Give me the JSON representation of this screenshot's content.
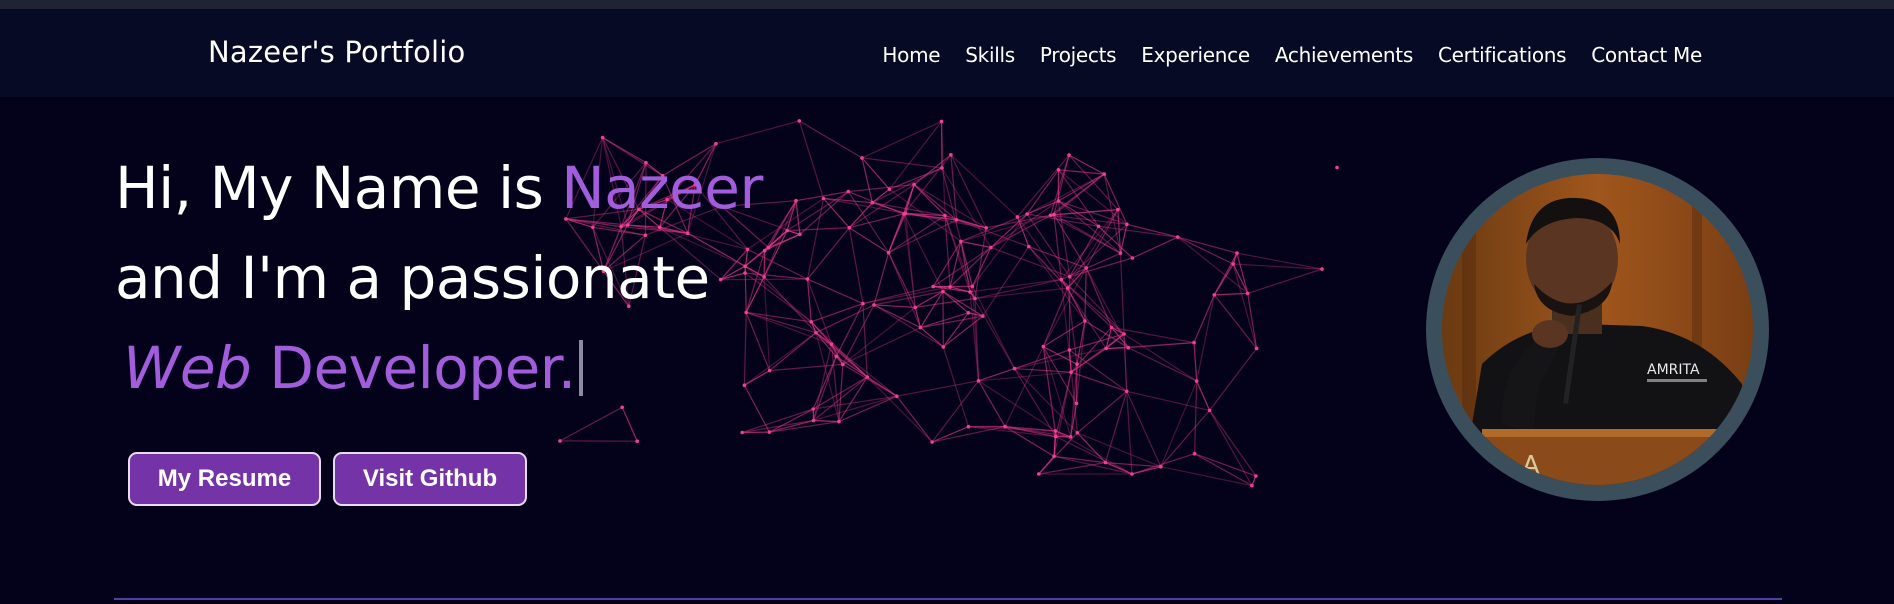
{
  "navbar": {
    "brand": "Nazeer's Portfolio",
    "links": [
      "Home",
      "Skills",
      "Projects",
      "Experience",
      "Achievements",
      "Certifications",
      "Contact Me"
    ]
  },
  "hero": {
    "line1_prefix": "Hi, My Name is ",
    "name": "Nazeer",
    "line2": "and I'm a passionate",
    "role_italic": "Web",
    "role_rest": " Developer."
  },
  "buttons": {
    "resume": "My Resume",
    "github": "Visit Github"
  },
  "profile": {
    "shirt_text": "AMRITA"
  },
  "colors": {
    "accent": "#a25ddc",
    "button_bg": "#7434a8",
    "network_lines": "#e0358a",
    "navbar_bg": "#070a24",
    "page_bg": "#03021a"
  }
}
